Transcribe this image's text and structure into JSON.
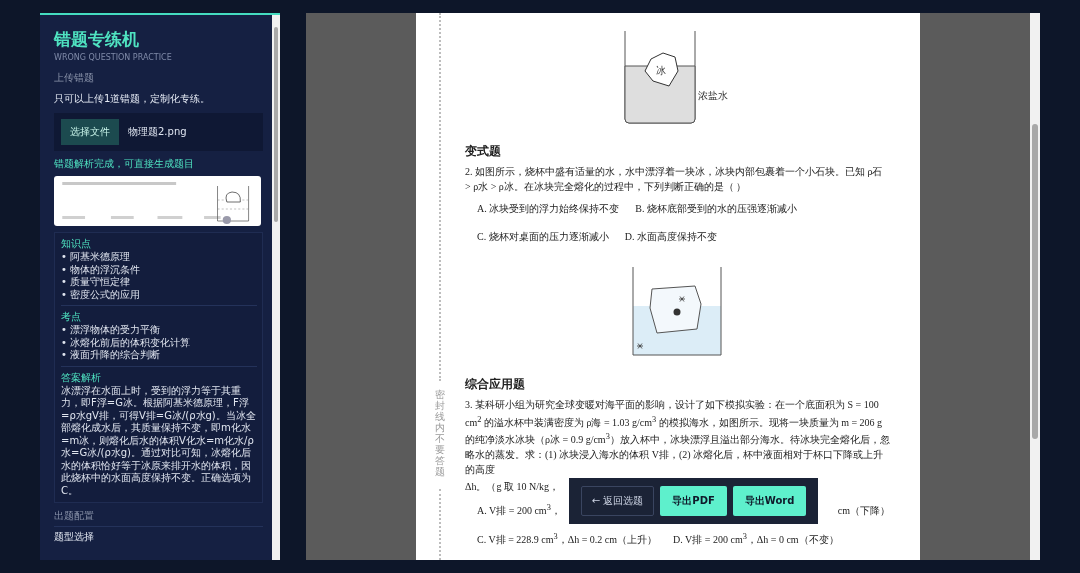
{
  "sidebar": {
    "title": "错题专练机",
    "subtitle": "WRONG QUESTION PRACTICE",
    "upload": {
      "heading": "上传错题",
      "description": "只可以上传1道错题，定制化专练。",
      "button": "选择文件",
      "file_name": "物理题2.png",
      "status": "错题解析完成，可直接生成题目"
    },
    "analysis": [
      {
        "kind": "list",
        "heading": "知识点",
        "items": [
          "• 阿基米德原理",
          "• 物体的浮沉条件",
          "• 质量守恒定律",
          "• 密度公式的应用"
        ]
      },
      {
        "kind": "list",
        "heading": "考点",
        "items": [
          "• 漂浮物体的受力平衡",
          "• 冰熔化前后的体积变化计算",
          "• 液面升降的综合判断"
        ]
      },
      {
        "kind": "text",
        "heading": "答案解析",
        "text": "冰漂浮在水面上时，受到的浮力等于其重力，即F浮=G冰。根据阿基米德原理，F浮=ρ水gV排，可得V排=G冰/(ρ水g)。当冰全部熔化成水后，其质量保持不变，即m化水=m冰，则熔化后水的体积V化水=m化水/ρ水=G冰/(ρ水g)。通过对比可知，冰熔化后水的体积恰好等于冰原来排开水的体积，因此烧杯中的水面高度保持不变。正确选项为C。"
      }
    ],
    "config": {
      "heading": "出题配置",
      "field_label": "题型选择"
    }
  },
  "document": {
    "binding_text": "密封线内不要答题",
    "figure_1": {
      "ice_label": "冰",
      "liquid_label": "浓盐水"
    },
    "sections": [
      {
        "heading": "变式题",
        "question": "2. 如图所示，烧杯中盛有适量的水，水中漂浮着一块冰，冰块内部包裹着一个小石块。已知 ρ石 > ρ水 > ρ冰。在冰块完全熔化的过程中，下列判断正确的是（ ）",
        "option_rows": [
          [
            "A. 冰块受到的浮力始终保持不变",
            "B. 烧杯底部受到的水的压强逐渐减小"
          ],
          [
            "C. 烧杯对桌面的压力逐渐减小",
            "D. 水面高度保持不变"
          ]
        ]
      },
      {
        "heading": "综合应用题",
        "question": "3. 某科研小组为研究全球变暖对海平面的影响，设计了如下模拟实验：在一个底面积为 S = 100 cm$^{2}$ 的溢水杯中装满密度为 ρ海 = 1.03 g/cm$^{3}$ 的模拟海水，如图所示。现将一块质量为 m = 206 g 的纯净淡水冰块（ρ冰 = 0.9 g/cm$^{3}$）放入杯中，冰块漂浮且溢出部分海水。待冰块完全熔化后，忽略水的蒸发。求：(1) 冰块浸入海水的体积 V排，(2) 冰熔化后，杯中液面相对于杯口下降或上升的高度",
        "question_tail": "Δh。（g 取 10 N/kg，",
        "covered_row": [
          "A. V排 = 200 cm$^{3}$，",
          "cm（下降）"
        ],
        "option_rows": [
          [
            "C. V排 = 228.9 cm$^{3}$，Δh = 0.2 cm（上升）",
            "D. V排 = 200 cm$^{3}$，Δh = 0 cm（不变）"
          ]
        ]
      }
    ]
  },
  "toolbar": {
    "back_button": "← 返回选题",
    "buttons": [
      "导出PDF",
      "导出Word"
    ]
  }
}
